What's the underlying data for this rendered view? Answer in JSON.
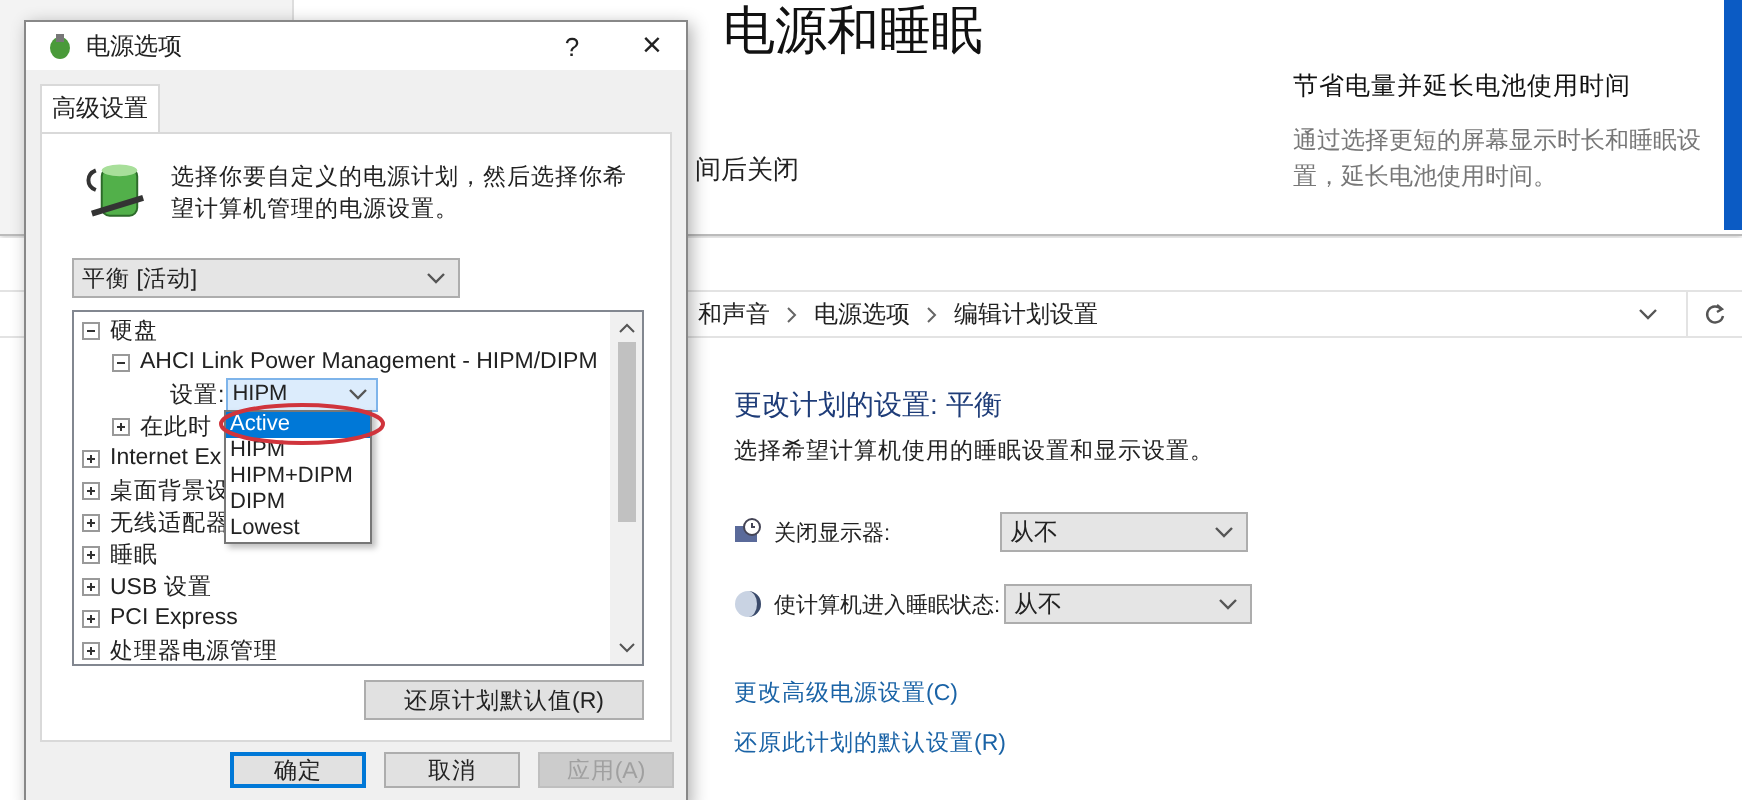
{
  "settings_window": {
    "title": "电源和睡眠",
    "partial_text": "间后关闭",
    "tip_title": "节省电量并延长电池使用时间",
    "tip_text": "通过选择更短的屏幕显示时长和睡眠设置，延长电池使用时间。"
  },
  "control_panel": {
    "breadcrumb": [
      "和声音",
      "电源选项",
      "编辑计划设置"
    ],
    "heading": "更改计划的设置: 平衡",
    "subheading": "选择希望计算机使用的睡眠设置和显示设置。",
    "settings": [
      {
        "kind": "display",
        "label": "关闭显示器:",
        "value": "从不"
      },
      {
        "kind": "sleep",
        "label": "使计算机进入睡眠状态:",
        "value": "从不"
      }
    ],
    "links": [
      "更改高级电源设置(C)",
      "还原此计划的默认设置(R)"
    ]
  },
  "dialog": {
    "title": "电源选项",
    "help": "?",
    "close": "×",
    "tabs": [
      {
        "label": "高级设置",
        "selected": true
      }
    ],
    "intro": "选择你要自定义的电源计划，然后选择你希望计算机管理的电源设置。",
    "plan": "平衡 [活动]",
    "tree": [
      {
        "label": "硬盘",
        "expanded": true,
        "children": [
          {
            "label": "AHCI Link Power Management - HIPM/DIPM",
            "expanded": true,
            "children": [
              {
                "kind": "setting",
                "label": "设置:",
                "value": "HIPM",
                "open": true,
                "options": [
                  {
                    "label": "Active",
                    "highlighted": true,
                    "circled": true
                  },
                  {
                    "label": "HIPM",
                    "highlighted": false,
                    "circled": false
                  },
                  {
                    "label": "HIPM+DIPM",
                    "highlighted": false,
                    "circled": false
                  },
                  {
                    "label": "DIPM",
                    "highlighted": false,
                    "circled": false
                  },
                  {
                    "label": "Lowest",
                    "highlighted": false,
                    "circled": false
                  }
                ]
              }
            ]
          },
          {
            "label": "在此时",
            "expanded": false
          }
        ]
      },
      {
        "label": "Internet Ex",
        "expanded": false
      },
      {
        "label": "桌面背景设",
        "expanded": false
      },
      {
        "label": "无线适配器",
        "expanded": false
      },
      {
        "label": "睡眠",
        "expanded": false
      },
      {
        "label": "USB 设置",
        "expanded": false
      },
      {
        "label": "PCI Express",
        "expanded": false
      },
      {
        "label": "处理器电源管理",
        "expanded": false
      }
    ],
    "restore_button": "还原计划默认值(R)",
    "buttons": [
      {
        "label": "确定",
        "default": true,
        "disabled": false
      },
      {
        "label": "取消",
        "default": false,
        "disabled": false
      },
      {
        "label": "应用(A)",
        "default": false,
        "disabled": true
      }
    ]
  }
}
